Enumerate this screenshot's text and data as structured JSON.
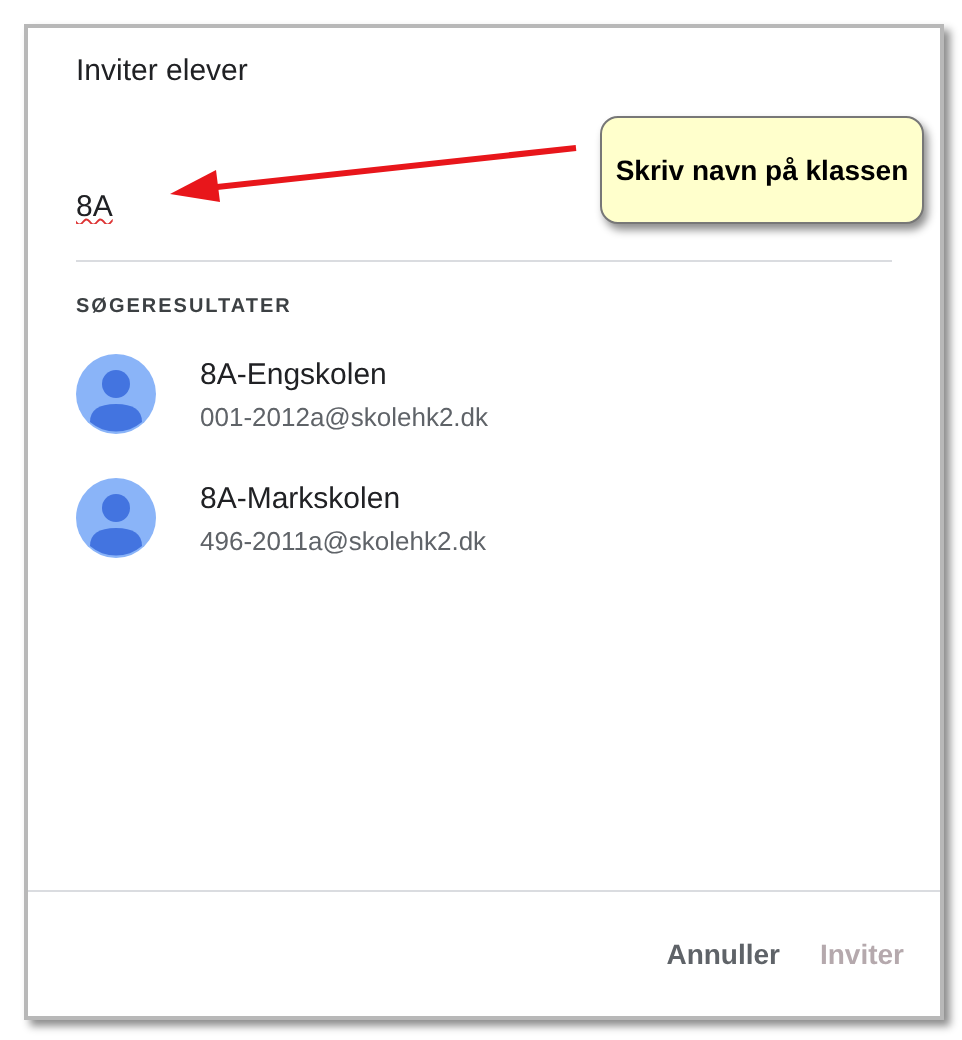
{
  "dialog": {
    "title": "Inviter elever",
    "search": {
      "value": "8A"
    },
    "results_heading": "SØGERESULTATER",
    "results": [
      {
        "name": "8A-Engskolen",
        "email": "001-2012a@skolehk2.dk"
      },
      {
        "name": "8A-Markskolen",
        "email": "496-2011a@skolehk2.dk"
      }
    ],
    "buttons": [
      {
        "label": "Annuller",
        "disabled": false
      },
      {
        "label": "Inviter",
        "disabled": true
      }
    ]
  },
  "callout": {
    "text": "Skriv navn på klassen"
  }
}
